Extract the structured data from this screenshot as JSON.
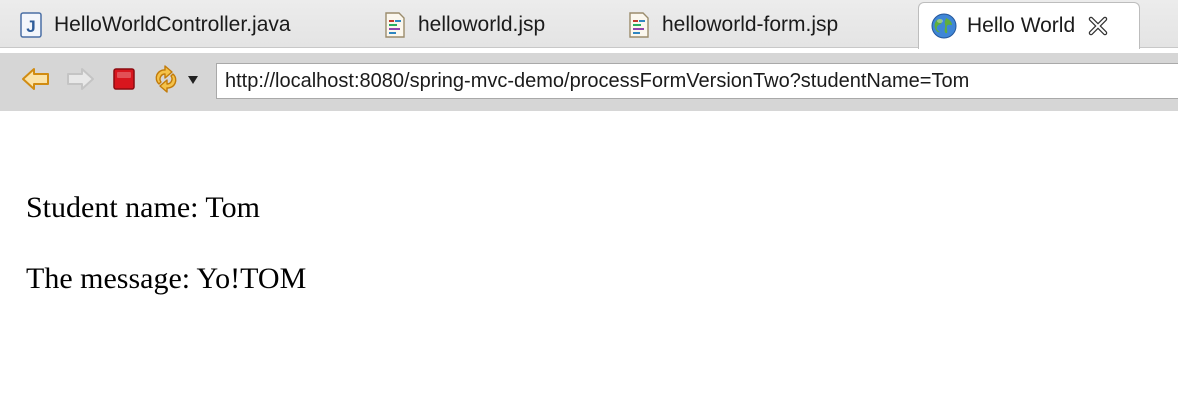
{
  "tabs": [
    {
      "label": "HelloWorldController.java",
      "icon": "java-file-icon",
      "active": false
    },
    {
      "label": "helloworld.jsp",
      "icon": "jsp-file-icon",
      "active": false
    },
    {
      "label": "helloworld-form.jsp",
      "icon": "jsp-file-icon",
      "active": false
    },
    {
      "label": "Hello World",
      "icon": "globe-icon",
      "active": true
    }
  ],
  "toolbar": {
    "back_icon": "back-arrow-icon",
    "forward_icon": "forward-arrow-icon",
    "stop_icon": "stop-icon",
    "refresh_icon": "refresh-icon",
    "url": "http://localhost:8080/spring-mvc-demo/processFormVersionTwo?studentName=Tom"
  },
  "page": {
    "line1": "Student name: Tom",
    "line2": "The message: Yo!TOM"
  },
  "colors": {
    "back_arrow": "#e6a21c",
    "stop": "#d8161e",
    "refresh": "#e6a21c"
  }
}
